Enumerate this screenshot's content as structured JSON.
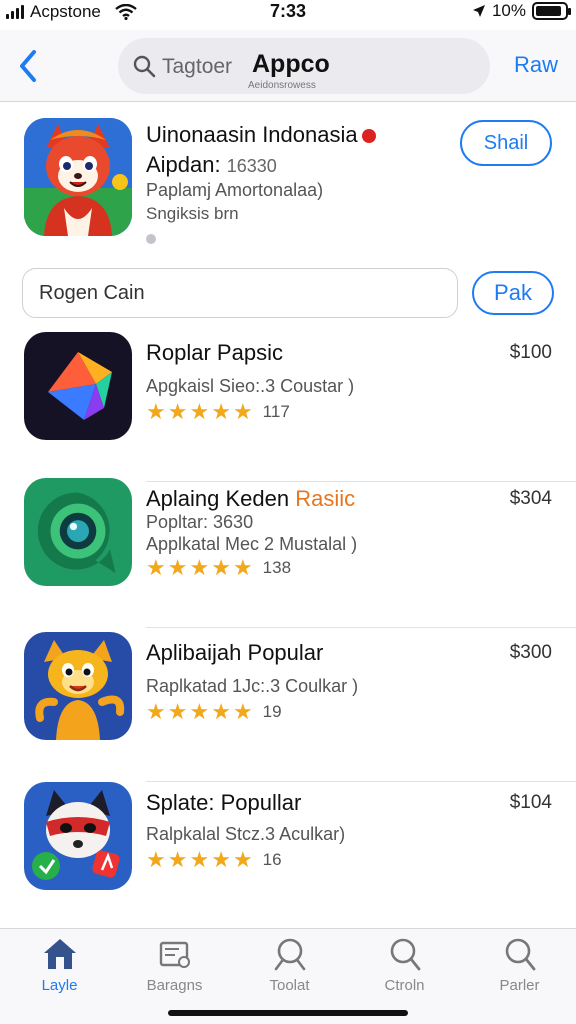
{
  "status_bar": {
    "carrier": "Acpstone",
    "time": "7:33",
    "battery_text": "10%",
    "battery_level": 0.9
  },
  "header": {
    "back_icon": "chevron-left-icon",
    "search_placeholder": "Tagtoer",
    "title": "Appco",
    "subtitle": "Aeidonsrowess",
    "right_link": "Raw"
  },
  "featured": {
    "title": "Uinonaasin Indonasia",
    "line2_label": "Aipdan:",
    "line2_value": "16330",
    "line3": "Paplamj Amortonalaa)",
    "line4": "Sngiksis brn",
    "button_label": "Shail"
  },
  "search_row": {
    "input_value": "Rogen Cain",
    "button_label": "Pak"
  },
  "apps": [
    {
      "title": "Roplar Papsic",
      "price": "$100",
      "sub1": "Apgkaisl Sieo:.3 Coustar )",
      "sub2": "",
      "stars": 5,
      "rating": "117",
      "accent": ""
    },
    {
      "title": "Aplaing Keden",
      "accent": "Rasiic",
      "price": "$304",
      "sub1": "Popltar: 3630",
      "sub2": "Applkatal Mec 2 Mustalal )",
      "stars": 5,
      "rating": "138"
    },
    {
      "title": "Aplibaijah Popular",
      "price": "$300",
      "sub1": "Raplkatad 1Jc:.3 Coulkar )",
      "sub2": "",
      "stars": 5,
      "rating": "19",
      "accent": ""
    },
    {
      "title": "Splate: Popullar",
      "price": "$104",
      "sub1": "Ralpkalal Stcz.3 Aculkar)",
      "sub2": "",
      "stars": 5,
      "rating": "16",
      "accent": ""
    }
  ],
  "tabs": [
    {
      "label": "Layle",
      "icon": "house-icon",
      "active": true
    },
    {
      "label": "Baragns",
      "icon": "folder-icon",
      "active": false
    },
    {
      "label": "Toolat",
      "icon": "search-icon",
      "active": false
    },
    {
      "label": "Ctroln",
      "icon": "search-icon",
      "active": false
    },
    {
      "label": "Parler",
      "icon": "search-icon",
      "active": false
    }
  ],
  "colors": {
    "accent_blue": "#1e7cf0",
    "star_gold": "#f2a81d",
    "accent_orange": "#e8761e"
  }
}
